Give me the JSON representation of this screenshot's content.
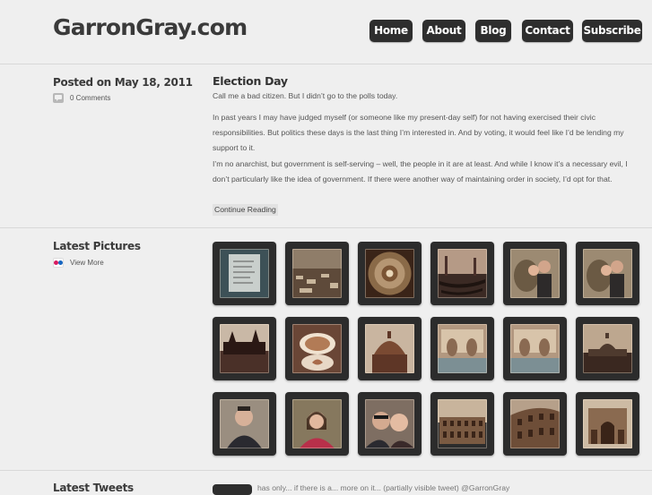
{
  "site": {
    "title": "GarronGray.com"
  },
  "nav": [
    {
      "label": "Home"
    },
    {
      "label": "About"
    },
    {
      "label": "Blog"
    },
    {
      "label": "Contact"
    },
    {
      "label": "Subscribe"
    }
  ],
  "post": {
    "date_label": "Posted on May 18, 2011",
    "comments_label": "0 Comments",
    "title": "Election Day",
    "paragraphs": [
      "Call me a bad citizen. But I didn’t go to the polls today.",
      "In past years I may have judged myself (or someone like my present-day self) for not having exercised their civic responsibilities. But politics these days is the last thing I’m interested in. And by voting, it would feel like I’d be lending my support to it.",
      "I’m no anarchist, but government is self-serving – well, the people in it are at least. And while I know it’s a necessary evil, I don’t particularly like the idea of government. If there were another way of maintaining order in society, I’d opt for that."
    ],
    "continue_label": "Continue Reading"
  },
  "pictures": {
    "heading": "Latest Pictures",
    "view_more_label": "View More",
    "flickr_colors": [
      "#d81b60",
      "#1565c0"
    ],
    "rows": [
      [
        "note-card",
        "aerial-city",
        "dome-interior",
        "gondolas",
        "couple-lion-statue",
        "couple-lion-statue"
      ],
      [
        "venice-palace",
        "latte-art",
        "church-dome",
        "fountain-statues",
        "fountain-statues",
        "st-peters"
      ],
      [
        "man-portrait",
        "woman-portrait",
        "couple-selfie",
        "colosseum",
        "colosseum-wall",
        "arch-of-constantine"
      ]
    ]
  },
  "tweets": {
    "heading": "Latest Tweets",
    "text": "has only... if there is a... more on it... (partially visible tweet) @GarronGray"
  }
}
